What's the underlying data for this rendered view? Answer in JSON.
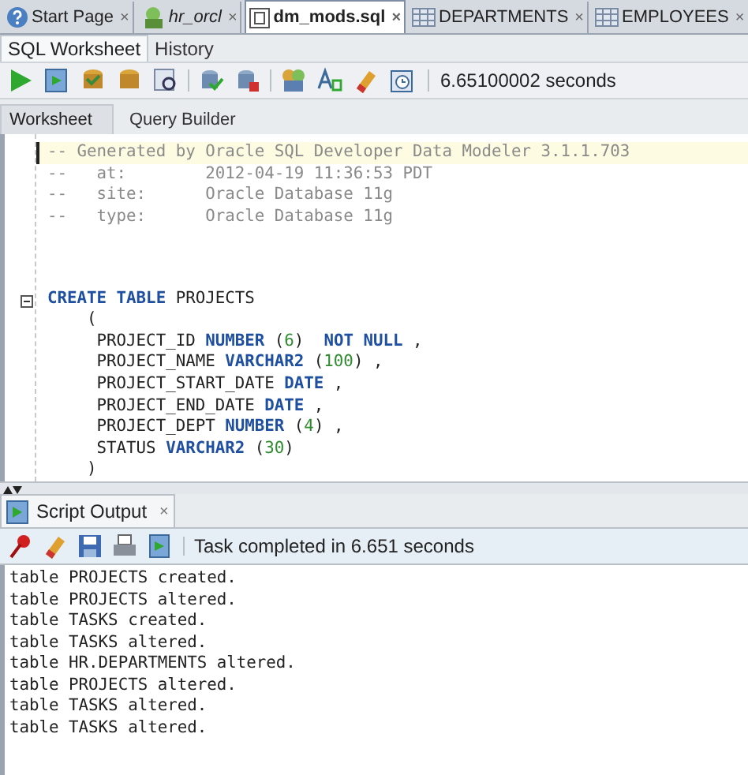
{
  "editor_tabs": [
    {
      "label": "Start Page",
      "kind": "help",
      "selected": false
    },
    {
      "label": "hr_orcl",
      "kind": "connection",
      "selected": false
    },
    {
      "label": "dm_mods.sql",
      "kind": "sql",
      "selected": true
    },
    {
      "label": "DEPARTMENTS",
      "kind": "table",
      "selected": false
    },
    {
      "label": "EMPLOYEES",
      "kind": "table",
      "selected": false
    }
  ],
  "close_glyph": "×",
  "worksheet_tabs": [
    {
      "label": "SQL Worksheet",
      "selected": true
    },
    {
      "label": "History",
      "selected": false
    }
  ],
  "toolbar": {
    "timing": "6.65100002 seconds"
  },
  "view_tabs": [
    {
      "label": "Worksheet",
      "selected": true
    },
    {
      "label": "Query Builder",
      "selected": false
    }
  ],
  "code_lines": [
    {
      "current": true,
      "segments": [
        {
          "kind": "comment",
          "text": "-- Generated by Oracle SQL Developer Data Modeler 3.1.1.703"
        }
      ]
    },
    {
      "current": false,
      "segments": [
        {
          "kind": "comment",
          "text": "--   at:        2012-04-19 11:36:53 PDT"
        }
      ]
    },
    {
      "current": false,
      "segments": [
        {
          "kind": "comment",
          "text": "--   site:      Oracle Database 11g"
        }
      ]
    },
    {
      "current": false,
      "segments": [
        {
          "kind": "comment",
          "text": "--   type:      Oracle Database 11g"
        }
      ]
    },
    {
      "current": false
    },
    {
      "current": false
    },
    {
      "current": false
    },
    {
      "current": false,
      "fold": true,
      "segments": [
        {
          "kind": "keyword",
          "text": "CREATE TABLE"
        },
        {
          "kind": "plain",
          "text": " PROJECTS"
        }
      ]
    },
    {
      "current": false,
      "segments": [
        {
          "kind": "plain",
          "text": "    ("
        }
      ]
    },
    {
      "current": false,
      "segments": [
        {
          "kind": "plain",
          "text": "     PROJECT_ID "
        },
        {
          "kind": "keyword",
          "text": "NUMBER"
        },
        {
          "kind": "plain",
          "text": " ("
        },
        {
          "kind": "number",
          "text": "6"
        },
        {
          "kind": "plain",
          "text": ")  "
        },
        {
          "kind": "keyword",
          "text": "NOT NULL"
        },
        {
          "kind": "plain",
          "text": " ,"
        }
      ]
    },
    {
      "current": false,
      "segments": [
        {
          "kind": "plain",
          "text": "     PROJECT_NAME "
        },
        {
          "kind": "keyword",
          "text": "VARCHAR2"
        },
        {
          "kind": "plain",
          "text": " ("
        },
        {
          "kind": "number",
          "text": "100"
        },
        {
          "kind": "plain",
          "text": ") ,"
        }
      ]
    },
    {
      "current": false,
      "segments": [
        {
          "kind": "plain",
          "text": "     PROJECT_START_DATE "
        },
        {
          "kind": "keyword",
          "text": "DATE"
        },
        {
          "kind": "plain",
          "text": " ,"
        }
      ]
    },
    {
      "current": false,
      "segments": [
        {
          "kind": "plain",
          "text": "     PROJECT_END_DATE "
        },
        {
          "kind": "keyword",
          "text": "DATE"
        },
        {
          "kind": "plain",
          "text": " ,"
        }
      ]
    },
    {
      "current": false,
      "segments": [
        {
          "kind": "plain",
          "text": "     PROJECT_DEPT "
        },
        {
          "kind": "keyword",
          "text": "NUMBER"
        },
        {
          "kind": "plain",
          "text": " ("
        },
        {
          "kind": "number",
          "text": "4"
        },
        {
          "kind": "plain",
          "text": ") ,"
        }
      ]
    },
    {
      "current": false,
      "segments": [
        {
          "kind": "plain",
          "text": "     STATUS "
        },
        {
          "kind": "keyword",
          "text": "VARCHAR2"
        },
        {
          "kind": "plain",
          "text": " ("
        },
        {
          "kind": "number",
          "text": "30"
        },
        {
          "kind": "plain",
          "text": ")"
        }
      ]
    },
    {
      "current": false,
      "segments": [
        {
          "kind": "plain",
          "text": "    )"
        }
      ]
    }
  ],
  "output_panel": {
    "tab": {
      "label": "Script Output",
      "selected": true
    },
    "status": "Task completed in 6.651 seconds",
    "lines": [
      "table PROJECTS created.",
      "table PROJECTS altered.",
      "table TASKS created.",
      "table TASKS altered.",
      "table HR.DEPARTMENTS altered.",
      "table PROJECTS altered.",
      "table TASKS altered.",
      "table TASKS altered."
    ]
  }
}
